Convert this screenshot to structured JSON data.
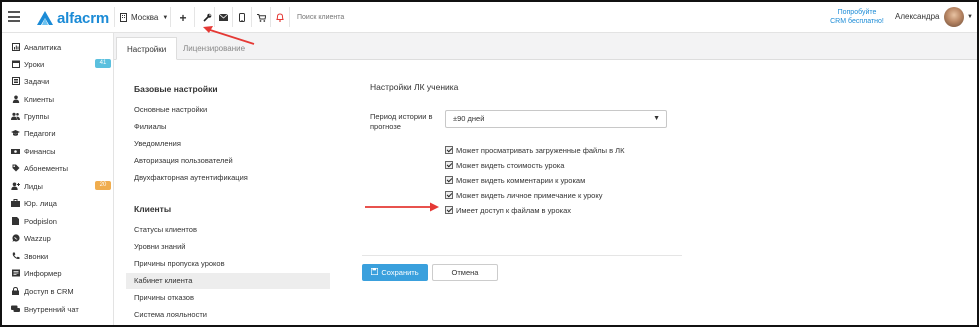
{
  "header": {
    "logo_text": "alfacrm",
    "branch": "Москва",
    "search_placeholder": "Поиск клиента",
    "trial_line1": "Попробуйте",
    "trial_line2": "CRM бесплатно!",
    "user_name": "Александра",
    "icons": [
      "plus-icon",
      "wrench-icon",
      "envelope-icon",
      "phone-icon",
      "cart-icon",
      "bell-icon"
    ]
  },
  "sidebar": {
    "items": [
      {
        "label": "Аналитика",
        "icon": "dashboard-icon"
      },
      {
        "label": "Уроки",
        "icon": "calendar-icon",
        "badge": "41",
        "badge_color": "#5bc0de"
      },
      {
        "label": "Задачи",
        "icon": "tasks-icon"
      },
      {
        "label": "Клиенты",
        "icon": "user-icon"
      },
      {
        "label": "Группы",
        "icon": "users-icon"
      },
      {
        "label": "Педагоги",
        "icon": "graduation-cap-icon"
      },
      {
        "label": "Финансы",
        "icon": "money-icon"
      },
      {
        "label": "Абонементы",
        "icon": "tag-icon"
      },
      {
        "label": "Лиды",
        "icon": "user-plus-icon",
        "badge": "20",
        "badge_color": "#f0ad4e"
      },
      {
        "label": "Юр. лица",
        "icon": "briefcase-icon"
      },
      {
        "label": "Podpislon",
        "icon": "document-icon"
      },
      {
        "label": "Wazzup",
        "icon": "whatsapp-icon"
      },
      {
        "label": "Звонки",
        "icon": "phone-icon"
      },
      {
        "label": "Информер",
        "icon": "informer-icon"
      },
      {
        "label": "Доступ в CRM",
        "icon": "lock-icon"
      },
      {
        "label": "Внутренний чат",
        "icon": "chat-icon"
      }
    ]
  },
  "tabs": [
    {
      "label": "Настройки",
      "active": true
    },
    {
      "label": "Лицензирование",
      "active": false
    }
  ],
  "settings": {
    "basic_title": "Базовые настройки",
    "basic_items": [
      "Основные настройки",
      "Филиалы",
      "Уведомления",
      "Авторизация пользователей",
      "Двухфакторная аутентификация"
    ],
    "clients_title": "Клиенты",
    "clients_items": [
      "Статусы клиентов",
      "Уровни знаний",
      "Причины пропуска уроков",
      "Кабинет клиента",
      "Причины отказов",
      "Система лояльности"
    ],
    "active_item": "Кабинет клиента"
  },
  "form": {
    "title": "Настройки ЛК ученика",
    "period_label": "Период истории в прогнозе",
    "period_value": "±90 дней",
    "checkboxes": [
      {
        "label": "Может просматривать загруженные файлы в ЛК",
        "checked": true
      },
      {
        "label": "Может видеть стоимость урока",
        "checked": true
      },
      {
        "label": "Может видеть комментарии к урокам",
        "checked": true
      },
      {
        "label": "Может видеть личное примечание к уроку",
        "checked": true
      },
      {
        "label": "Имеет доступ к файлам в уроках",
        "checked": true
      }
    ],
    "save_label": "Сохранить",
    "cancel_label": "Отмена"
  },
  "colors": {
    "accent": "#3aa0dd",
    "brand": "#1b8bd6",
    "annotation": "#e53935"
  }
}
